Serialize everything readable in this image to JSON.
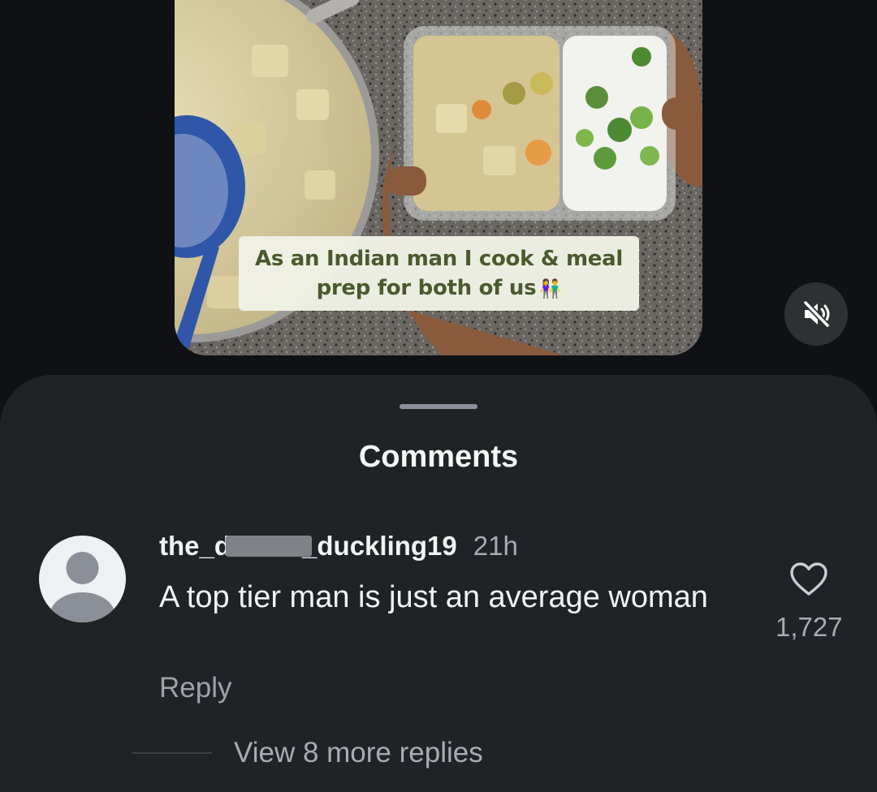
{
  "reel": {
    "caption_line1": "As an Indian man I cook & meal",
    "caption_line2": "prep for both of us",
    "caption_emoji": "👫",
    "mute_icon": "speaker-muted-icon"
  },
  "comments_sheet": {
    "title": "Comments",
    "comment": {
      "username_prefix": "the_",
      "username_hidden": "defiant",
      "username_suffix": "_duckling19",
      "timestamp": "21h",
      "text": "A top tier man is just an average woman",
      "reply_label": "Reply",
      "like_icon": "heart-outline-icon",
      "like_count": "1,727",
      "view_more_label": "View 8 more replies"
    }
  },
  "colors": {
    "background": "#0f1115",
    "sheet": "#202226",
    "primary_text": "#f1f2f4",
    "secondary_text": "#a9acb3",
    "caption_text": "#4a5a2c",
    "caption_bg": "#f0f2e5"
  }
}
